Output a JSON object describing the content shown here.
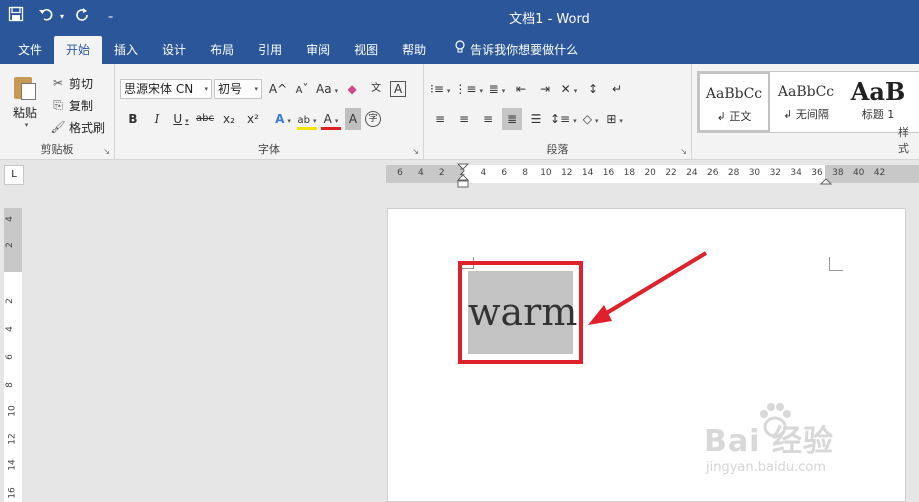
{
  "window": {
    "title": "文档1  -  Word"
  },
  "quick_access": {
    "save_icon": "save-icon",
    "undo_icon": "undo-icon",
    "redo_icon": "redo-icon",
    "customize_icon": "customize-qat-icon"
  },
  "tabs": [
    {
      "label": "文件"
    },
    {
      "label": "开始"
    },
    {
      "label": "插入"
    },
    {
      "label": "设计"
    },
    {
      "label": "布局"
    },
    {
      "label": "引用"
    },
    {
      "label": "审阅"
    },
    {
      "label": "视图"
    },
    {
      "label": "帮助"
    }
  ],
  "tell_me": "告诉我你想要做什么",
  "clipboard": {
    "paste": "粘贴",
    "cut": "剪切",
    "copy": "复制",
    "format_painter": "格式刷",
    "group_label": "剪贴板"
  },
  "font": {
    "font_name": "思源宋体 CN",
    "font_size": "初号",
    "group_label": "字体",
    "buttons": [
      "A",
      "A",
      "Aa",
      "B",
      "I",
      "U",
      "abc",
      "x₂",
      "x²",
      "A",
      "ab",
      "A",
      "A",
      "字",
      "文",
      "A"
    ]
  },
  "paragraph": {
    "group_label": "段落"
  },
  "styles": {
    "items": [
      {
        "sample": "AaBbCc",
        "name": "↲ 正文"
      },
      {
        "sample": "AaBbCc",
        "name": "↲ 无间隔"
      },
      {
        "sample": "AaB",
        "name": "标题 1"
      }
    ],
    "group_label": "样式"
  },
  "ruler": {
    "corner": "L",
    "h_ticks": [
      "6",
      "4",
      "2",
      "2",
      "4",
      "6",
      "8",
      "10",
      "12",
      "14",
      "16",
      "18",
      "20",
      "22",
      "24",
      "26",
      "28",
      "30",
      "32",
      "34",
      "36",
      "38",
      "40",
      "42"
    ],
    "v_ticks": [
      "4",
      "2",
      "2",
      "4",
      "6",
      "8",
      "10",
      "12",
      "14",
      "16"
    ]
  },
  "document": {
    "text": "warm"
  },
  "watermark": {
    "brand": "Bai  经验",
    "url": "jingyan.baidu.com"
  }
}
